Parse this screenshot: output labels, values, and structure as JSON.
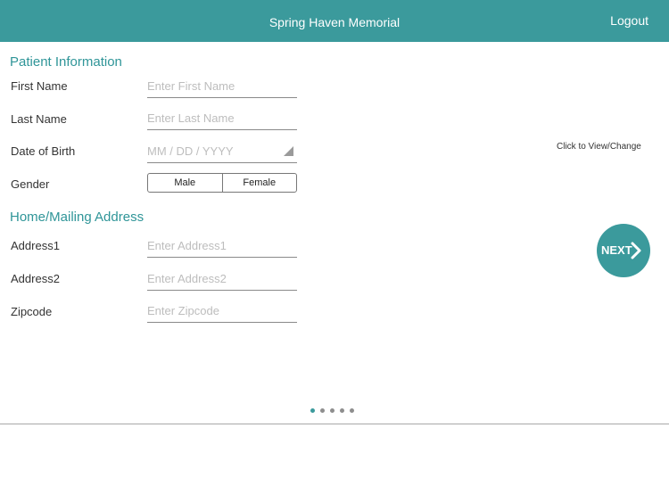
{
  "header": {
    "title": "Spring Haven Memorial",
    "logout_label": "Logout"
  },
  "patient_info": {
    "section_title": "Patient Information",
    "first_name": {
      "label": "First Name",
      "placeholder": "Enter First Name"
    },
    "last_name": {
      "label": "Last Name",
      "placeholder": "Enter Last Name"
    },
    "dob": {
      "label": "Date of Birth",
      "placeholder": "MM / DD / YYYY"
    },
    "gender": {
      "label": "Gender",
      "options": [
        "Male",
        "Female"
      ]
    },
    "view_change_label": "Click to View/Change"
  },
  "address": {
    "section_title": "Home/Mailing Address",
    "address1": {
      "label": "Address1",
      "placeholder": "Enter Address1"
    },
    "address2": {
      "label": "Address2",
      "placeholder": "Enter Address2"
    },
    "zipcode": {
      "label": "Zipcode",
      "placeholder": "Enter Zipcode"
    }
  },
  "next_button": {
    "label": "NEXT",
    "icon": "chevron-right-icon"
  },
  "pager": {
    "total_pages": 5,
    "current_page": 1
  },
  "colors": {
    "accent": "#3b9a9c",
    "section_title": "#2f9598",
    "placeholder": "#bdbdbd"
  }
}
